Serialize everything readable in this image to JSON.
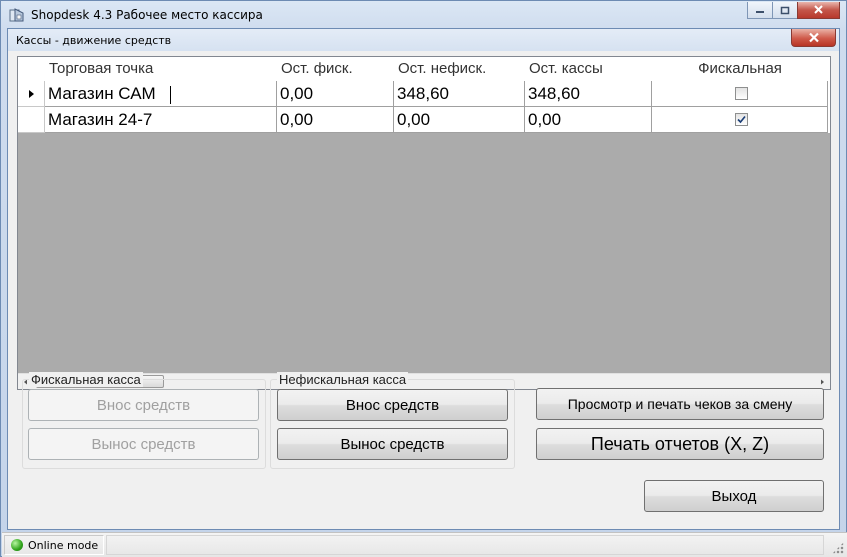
{
  "app": {
    "title": "Shopdesk 4.3 Рабочее место кассира",
    "icon": "shopdesk-app-icon"
  },
  "dialog": {
    "title": "Кассы - движение средств"
  },
  "grid": {
    "columns": [
      "Торговая точка",
      "Ост. фиск.",
      "Ост. нефиск.",
      "Ост. кассы",
      "Фискальная"
    ],
    "rows": [
      {
        "store": "Магазин САМ",
        "fiscal": "0,00",
        "nonfiscal": "348,60",
        "cash": "348,60",
        "is_fiscal": false,
        "current": true
      },
      {
        "store": "Магазин 24-7",
        "fiscal": "0,00",
        "nonfiscal": "0,00",
        "cash": "0,00",
        "is_fiscal": true,
        "current": false
      }
    ]
  },
  "fiscal_group": {
    "label": "Фискальная касса",
    "cash_in": "Внос средств",
    "cash_out": "Вынос средств",
    "enabled": false
  },
  "nonfiscal_group": {
    "label": "Нефискальная касса",
    "cash_in": "Внос средств",
    "cash_out": "Вынос средств",
    "enabled": true
  },
  "actions": {
    "view_receipts": "Просмотр и печать чеков за смену",
    "print_reports": "Печать отчетов (X, Z)",
    "exit": "Выход"
  },
  "status": {
    "mode": "Online mode",
    "indicator_color": "#2fa31a"
  }
}
